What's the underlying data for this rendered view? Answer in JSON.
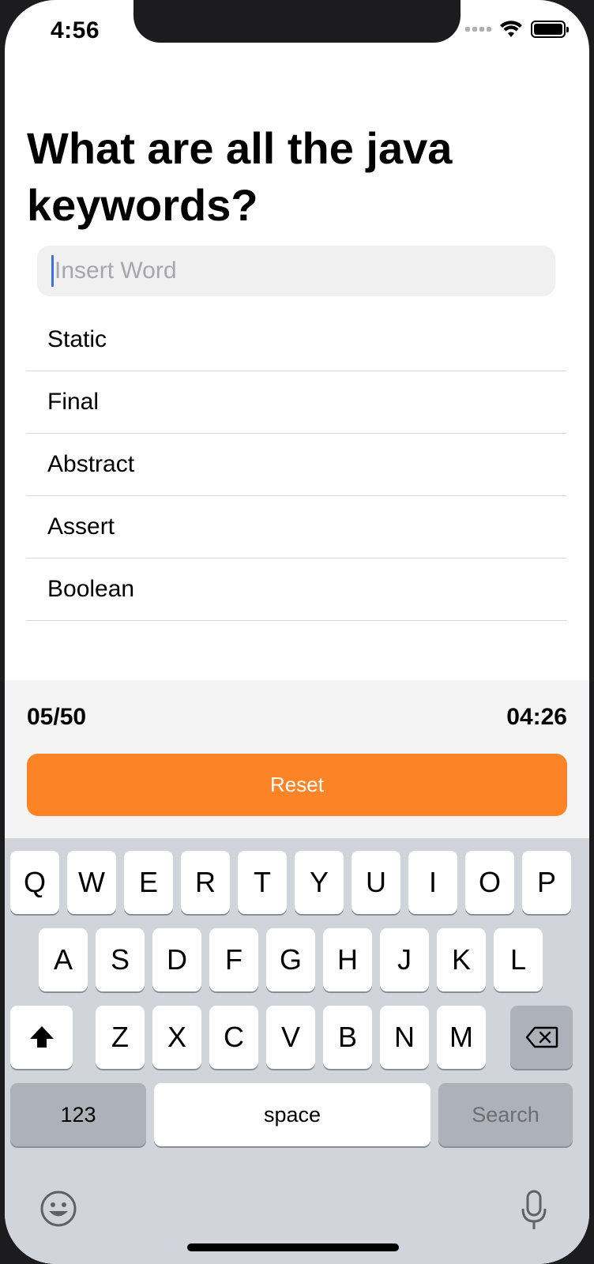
{
  "status_bar": {
    "time": "4:56"
  },
  "question": {
    "title": "What are all the java keywords?"
  },
  "search": {
    "placeholder": "Insert Word",
    "value": ""
  },
  "answers": [
    "Static",
    "Final",
    "Abstract",
    "Assert",
    "Boolean"
  ],
  "footer": {
    "score": "05/50",
    "timer": "04:26",
    "reset_label": "Reset"
  },
  "keyboard": {
    "row1": [
      "Q",
      "W",
      "E",
      "R",
      "T",
      "Y",
      "U",
      "I",
      "O",
      "P"
    ],
    "row2": [
      "A",
      "S",
      "D",
      "F",
      "G",
      "H",
      "J",
      "K",
      "L"
    ],
    "row3": [
      "Z",
      "X",
      "C",
      "V",
      "B",
      "N",
      "M"
    ],
    "numbers_label": "123",
    "space_label": "space",
    "search_label": "Search"
  },
  "icons": {
    "wifi": "wifi-icon",
    "battery": "battery-icon",
    "shift": "shift-icon",
    "backspace": "backspace-icon",
    "emoji": "emoji-icon",
    "mic": "microphone-icon"
  },
  "colors": {
    "accent": "#fc8427",
    "caret": "#3c6fe0",
    "keyboard_bg": "#d1d4da"
  }
}
